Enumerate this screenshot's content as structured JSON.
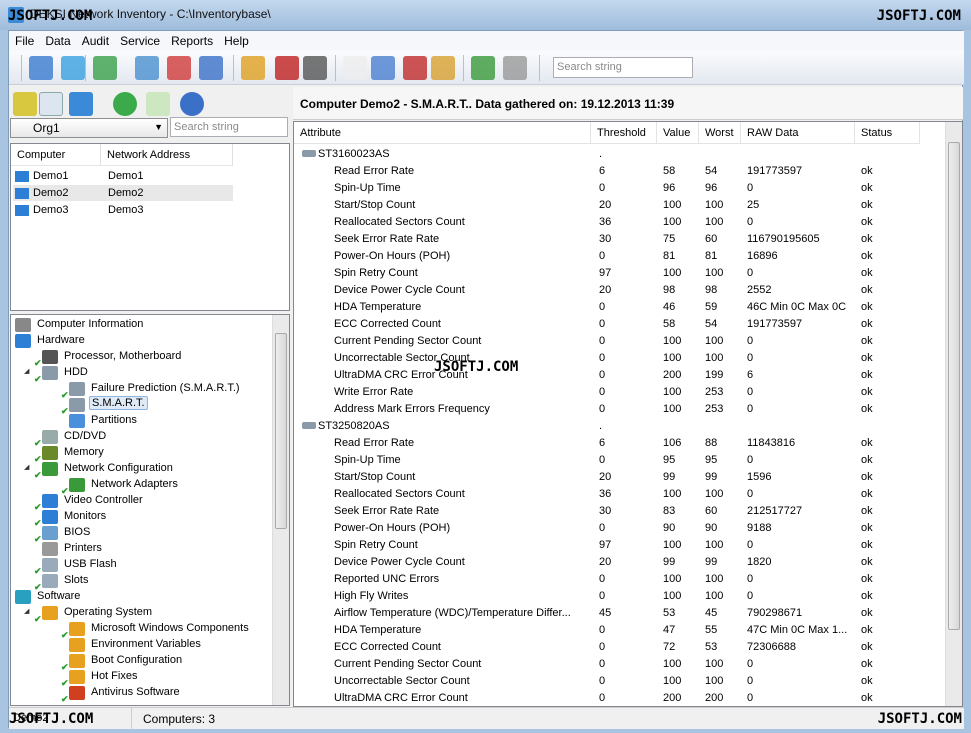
{
  "window": {
    "title": "DEKSI Network Inventory - C:\\Inventorybase\\",
    "watermark": "JSOFTJ.COM"
  },
  "menu": [
    "File",
    "Data",
    "Audit",
    "Service",
    "Reports",
    "Help"
  ],
  "toolbar": {
    "icons": [
      "import-icon",
      "refresh-icon",
      "add-computer-icon",
      "edit-computer-icon",
      "delete-computer-icon",
      "network-icon",
      "save-icon",
      "print-icon",
      "binoculars-icon",
      "preview-icon",
      "table-icon",
      "key-icon",
      "report-icon",
      "users-icon",
      "settings-icon"
    ],
    "search_placeholder": "Search string"
  },
  "left": {
    "org": "Org1",
    "search_placeholder": "Search string",
    "columns": [
      "Computer",
      "Network Address"
    ],
    "computers": [
      {
        "name": "Demo1",
        "address": "Demo1"
      },
      {
        "name": "Demo2",
        "address": "Demo2",
        "selected": true
      },
      {
        "name": "Demo3",
        "address": "Demo3"
      }
    ],
    "tree": [
      {
        "label": "Computer Information",
        "level": 0,
        "icon": "info-icon",
        "color": "#888"
      },
      {
        "label": "Hardware",
        "level": 0,
        "icon": "hardware-icon",
        "color": "#2d7fd6"
      },
      {
        "label": "Processor, Motherboard",
        "level": 1,
        "icon": "cpu-icon",
        "color": "#555",
        "check": true
      },
      {
        "label": "HDD",
        "level": 1,
        "icon": "hdd-icon",
        "color": "#8a9aa8",
        "check": true,
        "expanded": true
      },
      {
        "label": "Failure Prediction (S.M.A.R.T.)",
        "level": 2,
        "icon": "hdd-icon",
        "color": "#8a9aa8",
        "check": true
      },
      {
        "label": "S.M.A.R.T.",
        "level": 2,
        "icon": "hdd-icon",
        "color": "#8a9aa8",
        "check": true,
        "selected": true
      },
      {
        "label": "Partitions",
        "level": 2,
        "icon": "pie-icon",
        "color": "#4a8fdc"
      },
      {
        "label": "CD/DVD",
        "level": 1,
        "icon": "cd-icon",
        "color": "#9aa",
        "check": true
      },
      {
        "label": "Memory",
        "level": 1,
        "icon": "memory-icon",
        "color": "#6a8a2a",
        "check": true
      },
      {
        "label": "Network Configuration",
        "level": 1,
        "icon": "network-card-icon",
        "color": "#3a9a3a",
        "check": true,
        "expanded": true
      },
      {
        "label": "Network Adapters",
        "level": 2,
        "icon": "network-card-icon",
        "color": "#3a9a3a",
        "check": true
      },
      {
        "label": "Video Controller",
        "level": 1,
        "icon": "monitor-icon",
        "color": "#2d7fd6",
        "check": true
      },
      {
        "label": "Monitors",
        "level": 1,
        "icon": "monitor-icon",
        "color": "#2d7fd6",
        "check": true
      },
      {
        "label": "BIOS",
        "level": 1,
        "icon": "chip-icon",
        "color": "#6aa0d0",
        "check": true
      },
      {
        "label": "Printers",
        "level": 1,
        "icon": "printer-icon",
        "color": "#999"
      },
      {
        "label": "USB Flash",
        "level": 1,
        "icon": "usb-icon",
        "color": "#9ab",
        "check": true
      },
      {
        "label": "Slots",
        "level": 1,
        "icon": "slot-icon",
        "color": "#9ab",
        "check": true
      },
      {
        "label": "Software",
        "level": 0,
        "icon": "software-icon",
        "color": "#2aa0c0"
      },
      {
        "label": "Operating System",
        "level": 1,
        "icon": "windows-icon",
        "color": "#e8a020",
        "check": true,
        "expanded": true
      },
      {
        "label": "Microsoft Windows Components",
        "level": 2,
        "icon": "windows-icon",
        "color": "#e8a020",
        "check": true
      },
      {
        "label": "Environment Variables",
        "level": 2,
        "icon": "windows-icon",
        "color": "#e8a020"
      },
      {
        "label": "Boot Configuration",
        "level": 2,
        "icon": "windows-icon",
        "color": "#e8a020",
        "check": true
      },
      {
        "label": "Hot Fixes",
        "level": 2,
        "icon": "windows-icon",
        "color": "#e8a020",
        "check": true
      },
      {
        "label": "Antivirus Software",
        "level": 2,
        "icon": "shield-icon",
        "color": "#d04020",
        "check": true
      }
    ]
  },
  "right": {
    "title": "Computer Demo2 - S.M.A.R.T.. Data gathered on: 19.12.2013 11:39",
    "columns": [
      "Attribute",
      "Threshold",
      "Value",
      "Worst",
      "RAW Data",
      "Status"
    ],
    "rows": [
      {
        "disk": "ST3160023AS",
        "threshold": "."
      },
      [
        "Read Error Rate",
        "6",
        "58",
        "54",
        "191773597",
        "ok"
      ],
      [
        "Spin-Up Time",
        "0",
        "96",
        "96",
        "0",
        "ok"
      ],
      [
        "Start/Stop Count",
        "20",
        "100",
        "100",
        "25",
        "ok"
      ],
      [
        "Reallocated Sectors Count",
        "36",
        "100",
        "100",
        "0",
        "ok"
      ],
      [
        "Seek Error Rate Rate",
        "30",
        "75",
        "60",
        "116790195605",
        "ok"
      ],
      [
        "Power-On Hours (POH)",
        "0",
        "81",
        "81",
        "16896",
        "ok"
      ],
      [
        "Spin Retry Count",
        "97",
        "100",
        "100",
        "0",
        "ok"
      ],
      [
        "Device Power Cycle Count",
        "20",
        "98",
        "98",
        "2552",
        "ok"
      ],
      [
        "HDA Temperature",
        "0",
        "46",
        "59",
        "46C Min 0C Max 0C",
        "ok"
      ],
      [
        "ECC Corrected Count",
        "0",
        "58",
        "54",
        "191773597",
        "ok"
      ],
      [
        "Current Pending Sector Count",
        "0",
        "100",
        "100",
        "0",
        "ok"
      ],
      [
        "Uncorrectable Sector Count",
        "0",
        "100",
        "100",
        "0",
        "ok"
      ],
      [
        "UltraDMA CRC Error Count",
        "0",
        "200",
        "199",
        "6",
        "ok"
      ],
      [
        "Write Error Rate",
        "0",
        "100",
        "253",
        "0",
        "ok"
      ],
      [
        "Address Mark Errors Frequency",
        "0",
        "100",
        "253",
        "0",
        "ok"
      ],
      {
        "disk": "ST3250820AS",
        "threshold": "."
      },
      [
        "Read Error Rate",
        "6",
        "106",
        "88",
        "11843816",
        "ok"
      ],
      [
        "Spin-Up Time",
        "0",
        "95",
        "95",
        "0",
        "ok"
      ],
      [
        "Start/Stop Count",
        "20",
        "99",
        "99",
        "1596",
        "ok"
      ],
      [
        "Reallocated Sectors Count",
        "36",
        "100",
        "100",
        "0",
        "ok"
      ],
      [
        "Seek Error Rate Rate",
        "30",
        "83",
        "60",
        "212517727",
        "ok"
      ],
      [
        "Power-On Hours (POH)",
        "0",
        "90",
        "90",
        "9188",
        "ok"
      ],
      [
        "Spin Retry Count",
        "97",
        "100",
        "100",
        "0",
        "ok"
      ],
      [
        "Device Power Cycle Count",
        "20",
        "99",
        "99",
        "1820",
        "ok"
      ],
      [
        "Reported UNC Errors",
        "0",
        "100",
        "100",
        "0",
        "ok"
      ],
      [
        "High Fly Writes",
        "0",
        "100",
        "100",
        "0",
        "ok"
      ],
      [
        "Airflow Temperature (WDC)/Temperature Differ...",
        "45",
        "53",
        "45",
        "790298671",
        "ok"
      ],
      [
        "HDA Temperature",
        "0",
        "47",
        "55",
        "47C Min 0C Max 1...",
        "ok"
      ],
      [
        "ECC Corrected Count",
        "0",
        "72",
        "53",
        "72306688",
        "ok"
      ],
      [
        "Current Pending Sector Count",
        "0",
        "100",
        "100",
        "0",
        "ok"
      ],
      [
        "Uncorrectable Sector Count",
        "0",
        "100",
        "100",
        "0",
        "ok"
      ],
      [
        "UltraDMA CRC Error Count",
        "0",
        "200",
        "200",
        "0",
        "ok"
      ]
    ]
  },
  "status": {
    "left": "Demo2",
    "computers": "Computers: 3"
  }
}
